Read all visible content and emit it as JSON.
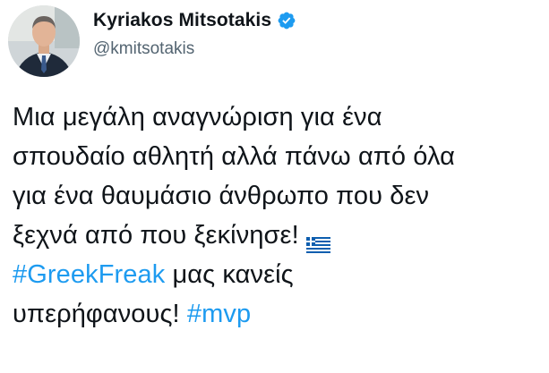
{
  "author": {
    "display_name": "Kyriakos Mitsotakis",
    "handle": "@kmitsotakis",
    "verified": true,
    "avatar_icon": "profile-photo"
  },
  "tweet": {
    "lines": [
      "Μια μεγάλη αναγνώριση για ένα",
      "σπουδαίο αθλητή αλλά πάνω από όλα",
      "για ένα θαυμάσιο άνθρωπο που δεν",
      "ξεχνά από που ξεκίνησε!"
    ],
    "flag_icon": "greece-flag-emoji",
    "hashtag_1": "#GreekFreak",
    "after_hashtag_1": " μας κανείς",
    "line_6_text": "υπερήφανους! ",
    "hashtag_2": "#mvp"
  },
  "colors": {
    "text": "#0f1419",
    "secondary": "#536471",
    "link": "#1d9bf0",
    "verified_badge": "#1d9bf0"
  }
}
